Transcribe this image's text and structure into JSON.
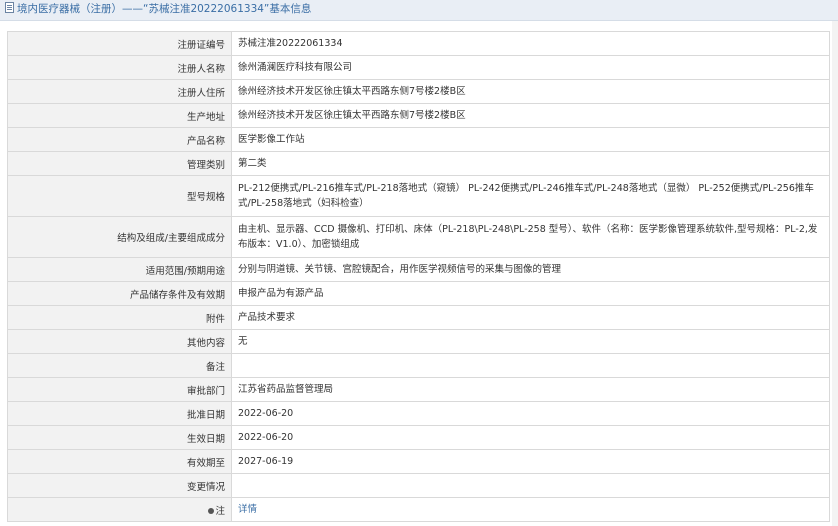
{
  "header": {
    "title": "境内医疗器械（注册）——“苏械注准20222061334”基本信息",
    "icon": "document-icon"
  },
  "rows": [
    {
      "label": "注册证编号",
      "value": "苏械注准20222061334"
    },
    {
      "label": "注册人名称",
      "value": "徐州涌澜医疗科技有限公司"
    },
    {
      "label": "注册人住所",
      "value": "徐州经济技术开发区徐庄镇太平西路东侧7号楼2楼B区"
    },
    {
      "label": "生产地址",
      "value": "徐州经济技术开发区徐庄镇太平西路东侧7号楼2楼B区"
    },
    {
      "label": "产品名称",
      "value": "医学影像工作站"
    },
    {
      "label": "管理类别",
      "value": "第二类"
    },
    {
      "label": "型号规格",
      "value": "PL-212便携式/PL-216推车式/PL-218落地式（窥镜） PL-242便携式/PL-246推车式/PL-248落地式（显微） PL-252便携式/PL-256推车式/PL-258落地式（妇科检查）"
    },
    {
      "label": "结构及组成/主要组成成分",
      "value": "由主机、显示器、CCD 摄像机、打印机、床体（PL-218\\PL-248\\PL-258 型号）、软件（名称：医学影像管理系统软件,型号规格：PL-2,发布版本：V1.0）、加密锁组成"
    },
    {
      "label": "适用范围/预期用途",
      "value": "分别与阴道镜、关节镜、宫腔镜配合，用作医学视频信号的采集与图像的管理"
    },
    {
      "label": "产品储存条件及有效期",
      "value": "申报产品为有源产品"
    },
    {
      "label": "附件",
      "value": "产品技术要求"
    },
    {
      "label": "其他内容",
      "value": "无"
    },
    {
      "label": "备注",
      "value": ""
    },
    {
      "label": "审批部门",
      "value": "江苏省药品监督管理局"
    },
    {
      "label": "批准日期",
      "value": "2022-06-20"
    },
    {
      "label": "生效日期",
      "value": "2022-06-20"
    },
    {
      "label": "有效期至",
      "value": "2027-06-19"
    },
    {
      "label": "变更情况",
      "value": ""
    }
  ],
  "note_row": {
    "label": "注",
    "link_text": "详情",
    "icon": "info-dot-icon"
  }
}
